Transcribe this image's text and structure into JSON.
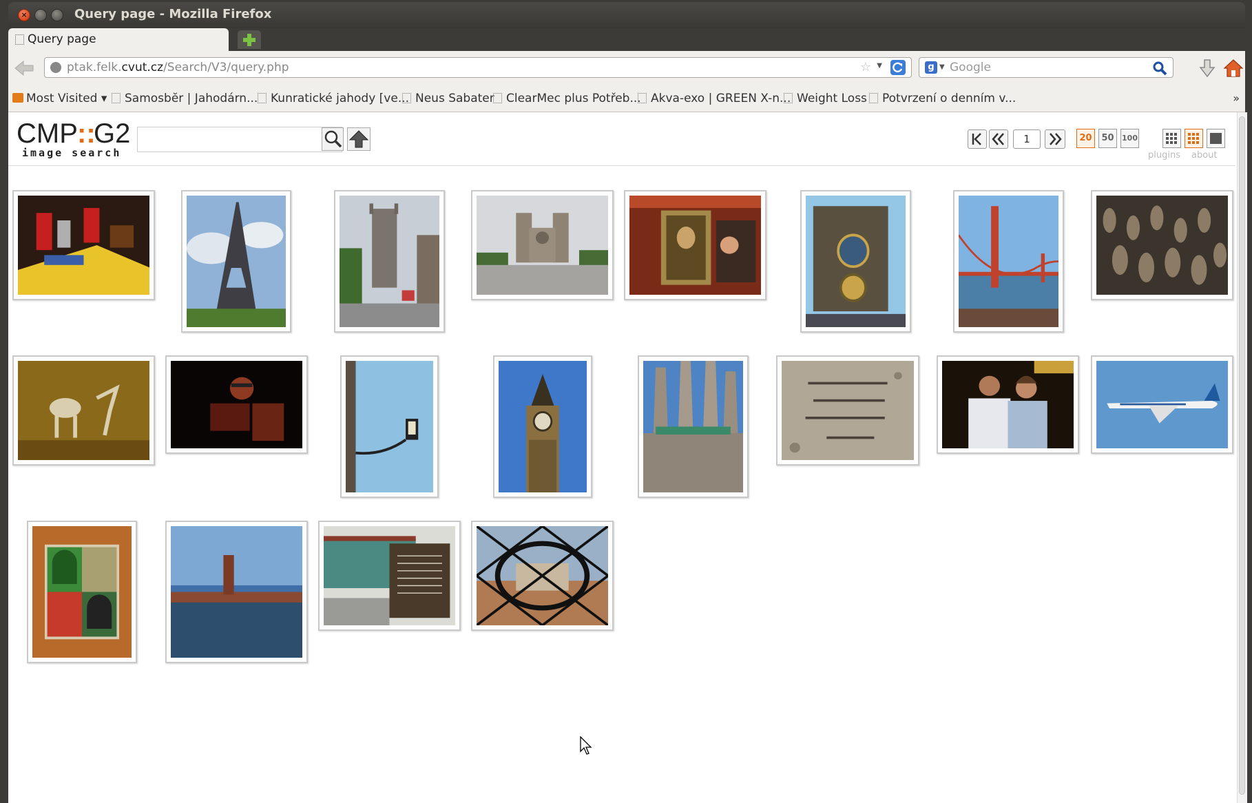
{
  "window": {
    "title": "Query page - Mozilla Firefox",
    "buttons": [
      "close",
      "minimize",
      "maximize"
    ]
  },
  "tabs": [
    {
      "label": "Query page",
      "favicon": "page-icon",
      "active": true
    }
  ],
  "navigation": {
    "url_prefix": "ptak.felk.",
    "url_domain": "cvut.cz",
    "url_path": "/Search/V3/query.php",
    "search_engine": "Google",
    "search_placeholder": "Google"
  },
  "bookmarks": [
    {
      "label": "Most Visited ▾",
      "icon": "most-visited-folder-icon"
    },
    {
      "label": "Samosbĕr | Jahodárn...",
      "icon": "page-icon"
    },
    {
      "label": "Kunratické jahody [ve...",
      "icon": "page-icon"
    },
    {
      "label": "Neus Sabater",
      "icon": "page-icon"
    },
    {
      "label": "ClearMec plus Potřeb...",
      "icon": "page-icon"
    },
    {
      "label": "Akva-exo | GREEN X-n...",
      "icon": "page-icon"
    },
    {
      "label": "Weight Loss",
      "icon": "page-icon"
    },
    {
      "label": "Potvrzení o denním v...",
      "icon": "page-icon"
    },
    {
      "label": "»",
      "icon": ""
    }
  ],
  "app": {
    "logo_top": "CMP",
    "logo_sep": "::",
    "logo_end": "G2",
    "logo_subtitle": "image search",
    "query_value": "",
    "pagination": {
      "current_page": "1"
    },
    "per_page_options": [
      "20",
      "50",
      "100"
    ],
    "per_page_selected": "20",
    "view_modes": [
      "small",
      "medium",
      "large"
    ],
    "view_mode_selected": "medium",
    "links": {
      "plugins": "plugins",
      "about": "about"
    },
    "accent_color": "#e36b12"
  },
  "results": [
    {
      "subject": "cola-cans-table",
      "orientation": "landscape"
    },
    {
      "subject": "eiffel-tower",
      "orientation": "portrait"
    },
    {
      "subject": "church-tower-street",
      "orientation": "portrait"
    },
    {
      "subject": "notre-dame",
      "orientation": "landscape"
    },
    {
      "subject": "mona-lisa-print",
      "orientation": "landscape"
    },
    {
      "subject": "astronomical-clock",
      "orientation": "portrait"
    },
    {
      "subject": "golden-gate-bridge",
      "orientation": "portrait"
    },
    {
      "subject": "terracotta-army",
      "orientation": "landscape"
    },
    {
      "subject": "horse-sculptures",
      "orientation": "landscape"
    },
    {
      "subject": "person-laptop-dark",
      "orientation": "landscape"
    },
    {
      "subject": "street-lamp",
      "orientation": "portrait"
    },
    {
      "subject": "big-ben",
      "orientation": "portrait"
    },
    {
      "subject": "sagrada-familia",
      "orientation": "portrait"
    },
    {
      "subject": "hebrew-stone-inscription",
      "orientation": "landscape"
    },
    {
      "subject": "couple-portrait",
      "orientation": "landscape"
    },
    {
      "subject": "airplane",
      "orientation": "landscape"
    },
    {
      "subject": "pacman-ghost-mosaic",
      "orientation": "portrait"
    },
    {
      "subject": "stockholm-city-hall",
      "orientation": "landscape"
    },
    {
      "subject": "nine-dragon-wall-sign",
      "orientation": "landscape"
    },
    {
      "subject": "city-through-fence",
      "orientation": "landscape"
    }
  ]
}
